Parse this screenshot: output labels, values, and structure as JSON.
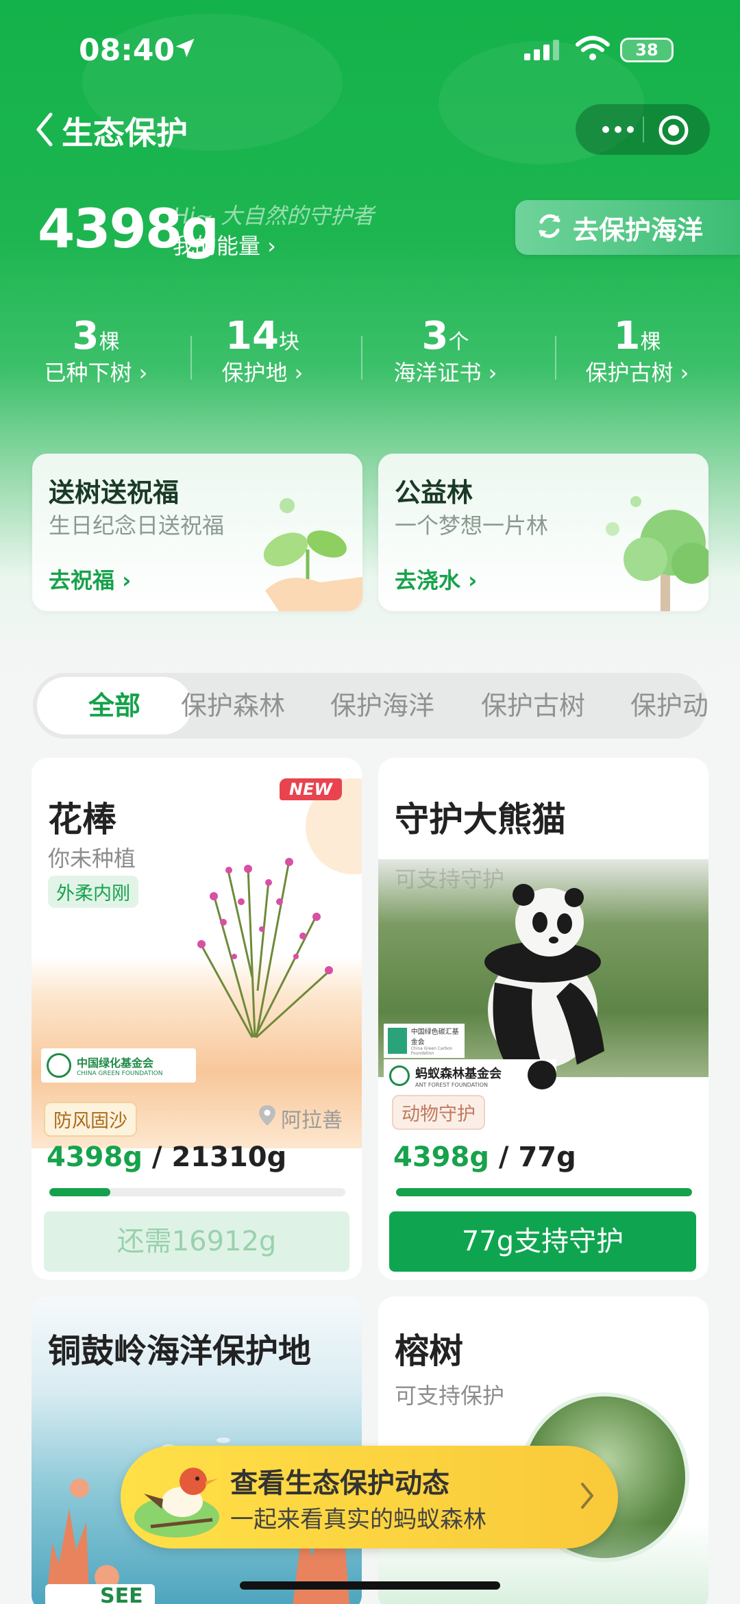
{
  "status_bar": {
    "time": "08:40",
    "battery": "38"
  },
  "header": {
    "title": "生态保护"
  },
  "energy": {
    "value": "4398g",
    "greeting": "Hi~ 大自然的守护者",
    "my_energy_label": "我的能量 ›",
    "ocean_button": "去保护海洋"
  },
  "stats": [
    {
      "num": "3",
      "unit": "棵",
      "label": "已种下树 ›"
    },
    {
      "num": "14",
      "unit": "块",
      "label": "保护地 ›"
    },
    {
      "num": "3",
      "unit": "个",
      "label": "海洋证书 ›"
    },
    {
      "num": "1",
      "unit": "棵",
      "label": "保护古树 ›"
    }
  ],
  "feature_cards": [
    {
      "title": "送树送祝福",
      "subtitle": "生日纪念日送祝福",
      "action": "去祝福 ›"
    },
    {
      "title": "公益林",
      "subtitle": "一个梦想一片林",
      "action": "去浇水 ›"
    }
  ],
  "tabs": [
    "全部",
    "保护森林",
    "保护海洋",
    "保护古树",
    "保护动"
  ],
  "projects": [
    {
      "name": "花棒",
      "subtitle": "你未种植",
      "tag": "外柔内刚",
      "badge": "NEW",
      "org": "中国绿化基金会",
      "org_en": "CHINA GREEN FOUNDATION",
      "type_tag": "防风固沙",
      "location": "阿拉善",
      "current": "4398g",
      "total": "21310g",
      "progress": 0.206,
      "button": "还需16912g"
    },
    {
      "name": "守护大熊猫",
      "subtitle": "可支持守护",
      "org1": "中国绿色碳汇基金会",
      "org1_en": "China Green Carbon Foundation",
      "org2": "蚂蚁森林基金会",
      "org2_en": "ANT FOREST FOUNDATION",
      "type_tag": "动物守护",
      "current": "4398g",
      "total": "77g",
      "progress": 1.0,
      "button": "77g支持守护"
    },
    {
      "name": "铜鼓岭海洋保护地",
      "org": "SEE"
    },
    {
      "name": "榕树",
      "subtitle": "可支持保护"
    }
  ],
  "banner": {
    "title": "查看生态保护动态",
    "subtitle": "一起来看真实的蚂蚁森林"
  },
  "colors": {
    "brand_green": "#13a24b",
    "header_green": "#14b24a",
    "banner_yellow": "#f9c93a"
  }
}
